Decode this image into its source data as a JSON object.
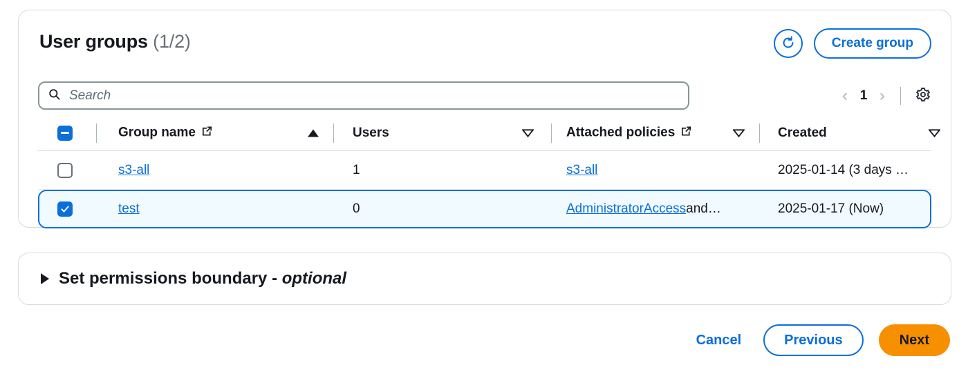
{
  "colors": {
    "accent_blue": "#0a6edb",
    "next_orange": "#f79000",
    "selected_row_bg": "#f1faff",
    "border_gray": "#d5dbdb",
    "muted_text": "#687078"
  },
  "card": {
    "title": "User groups",
    "count": "(1/2)",
    "refresh_icon": "refresh-icon",
    "create_button": "Create group"
  },
  "search": {
    "icon": "search-icon",
    "value": "",
    "placeholder": "Search"
  },
  "pagination": {
    "prev_icon": "chevron-left-icon",
    "current_page": "1",
    "next_icon": "chevron-right-icon",
    "settings_icon": "gear-icon"
  },
  "table": {
    "select_all_state": "indeterminate",
    "columns": [
      {
        "label": "Group name",
        "external_link": true,
        "sort": "ascending"
      },
      {
        "label": "Users",
        "external_link": false,
        "sort": "none"
      },
      {
        "label": "Attached policies",
        "external_link": true,
        "sort": "none"
      },
      {
        "label": "Created",
        "external_link": false,
        "sort": "none"
      }
    ],
    "rows": [
      {
        "selected": false,
        "group_name": "s3-all",
        "users": "1",
        "attached_policies": "s3-all",
        "attached_policies_suffix": "",
        "created": "2025-01-14 (3 days …"
      },
      {
        "selected": true,
        "group_name": "test",
        "users": "0",
        "attached_policies": "AdministratorAccess",
        "attached_policies_suffix": " and…",
        "created": "2025-01-17 (Now)"
      }
    ]
  },
  "permissions_boundary": {
    "caret_icon": "caret-right-icon",
    "label": "Set permissions boundary - ",
    "optional": "optional"
  },
  "footer": {
    "cancel": "Cancel",
    "previous": "Previous",
    "next": "Next"
  }
}
